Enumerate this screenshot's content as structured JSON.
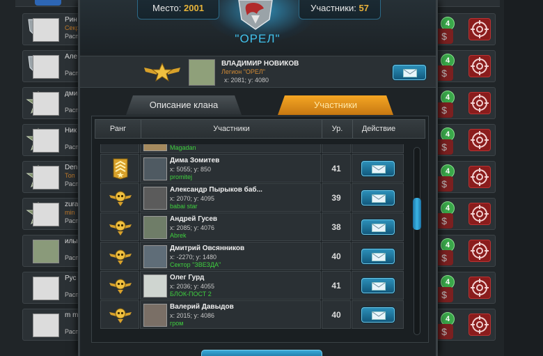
{
  "colors": {
    "accent": "#41c2ec",
    "gold": "#e7b43a",
    "legion_green": "#3fcf3f",
    "tab_active": "#f5a623"
  },
  "header": {
    "place_label": "Место:",
    "place_value": "2001",
    "members_label": "Участники:",
    "members_value": "57",
    "clan_name": "\"ОРЕЛ\""
  },
  "leader": {
    "name": "ВЛАДИМИР НОВИКОВ",
    "legion": "Легион \"ОРЕЛ\"",
    "coords": "x: 2081; y: 4080",
    "icon": "mail-icon"
  },
  "tabs": [
    {
      "label": "Описание клана",
      "active": false
    },
    {
      "label": "Участники",
      "active": true
    }
  ],
  "table": {
    "headers": {
      "rank": "Ранг",
      "members": "Участники",
      "level": "Ур.",
      "action": "Действие"
    },
    "partial_top": {
      "legion": "Magadan"
    },
    "rows": [
      {
        "name": "Дима Зомитев",
        "coords": "x: 5055; y: 850",
        "legion": "promitej",
        "level": "41",
        "rank_icon": "officer-rank-icon"
      },
      {
        "name": "Александр Пырыков баб...",
        "coords": "x: 2070; y: 4095",
        "legion": "babai star",
        "level": "39",
        "rank_icon": "winged-skull-rank-icon"
      },
      {
        "name": "Андрей Гусев",
        "coords": "x: 2085; y: 4076",
        "legion": "Abrek",
        "level": "38",
        "rank_icon": "winged-skull-rank-icon"
      },
      {
        "name": "Дмитрий Овсянников",
        "coords": "x: -2270; y: 1480",
        "legion": "Сектор \"ЗВЕЗДА\"",
        "level": "40",
        "rank_icon": "winged-skull-rank-icon"
      },
      {
        "name": "Олег Гурд",
        "coords": "x: 2036; y: 4055",
        "legion": "БЛОК-ПОСТ 2",
        "level": "41",
        "rank_icon": "winged-skull-rank-icon"
      },
      {
        "name": "Валерий Давыдов",
        "coords": "x: 2015; y: 4086",
        "legion": "гром",
        "level": "40",
        "rank_icon": "winged-skull-rank-icon"
      }
    ]
  },
  "background_list": [
    {
      "name": "Рин",
      "sub": "Секр",
      "sub2": "Расп",
      "badge": "4"
    },
    {
      "name": "Але",
      "sub": "",
      "sub2": "Расп",
      "badge": "4"
    },
    {
      "name": "дми",
      "sub": "",
      "sub2": "Расп",
      "badge": "4"
    },
    {
      "name": "Ник",
      "sub": "",
      "sub2": "Расп",
      "badge": "4"
    },
    {
      "name": "Den",
      "sub": "Топ",
      "sub2": "Расп",
      "badge": "4"
    },
    {
      "name": "zura",
      "sub": "min",
      "sub2": "Расп",
      "badge": "4"
    },
    {
      "name": "илы",
      "sub": "",
      "sub2": "Расп",
      "badge": "4"
    },
    {
      "name": "Рус",
      "sub": "",
      "sub2": "Расп",
      "badge": "4"
    },
    {
      "name": "m m",
      "sub": "",
      "sub2": "Расп",
      "badge": "4"
    }
  ]
}
